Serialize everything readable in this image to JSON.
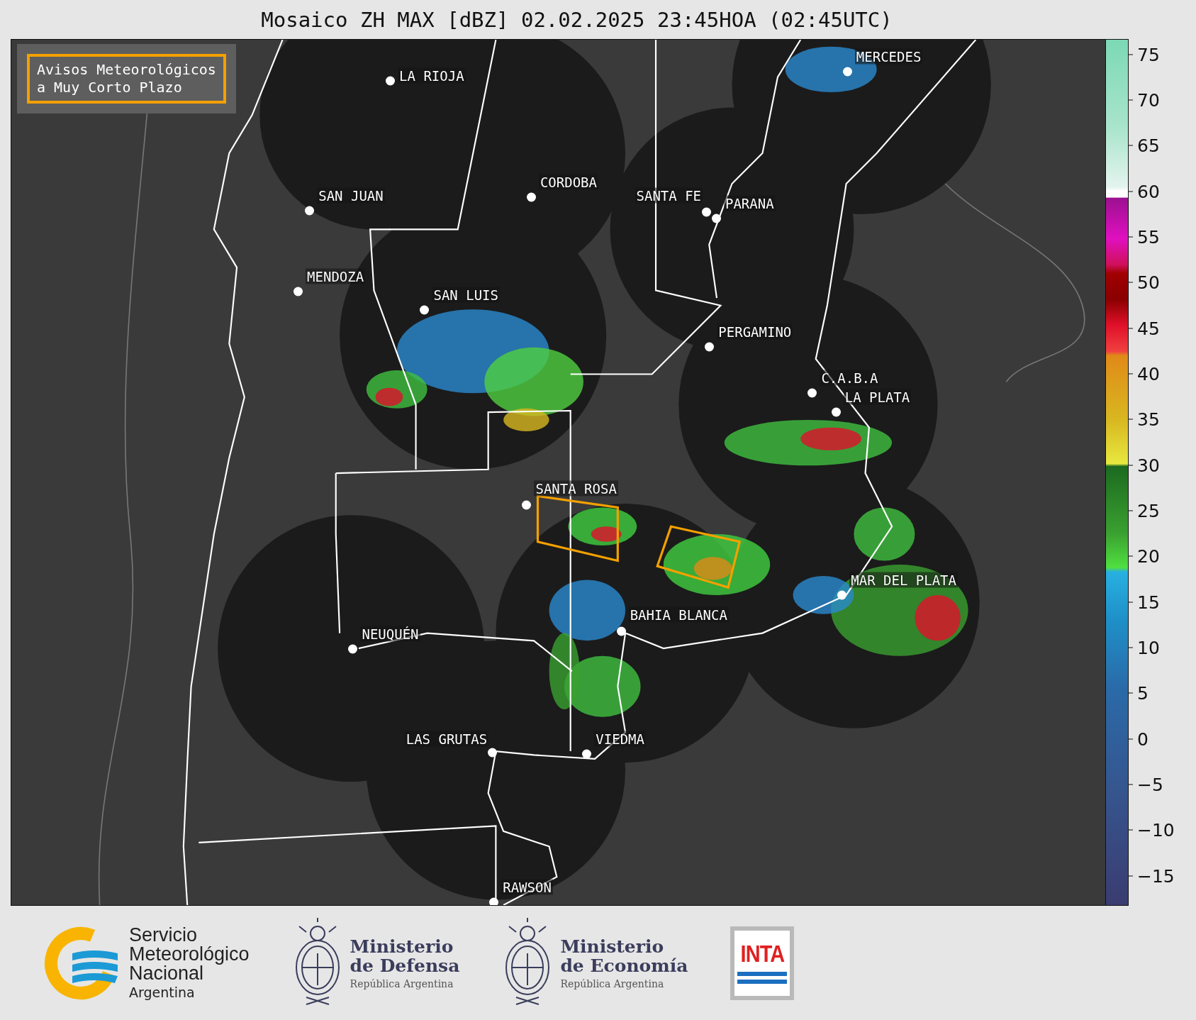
{
  "title": "Mosaico ZH MAX [dBZ] 02.02.2025 23:45HOA (02:45UTC)",
  "legend": {
    "text": "Avisos Meteorológicos a Muy Corto Plazo"
  },
  "cities": [
    {
      "name": "LA RIOJA"
    },
    {
      "name": "MERCEDES"
    },
    {
      "name": "SAN JUAN"
    },
    {
      "name": "CORDOBA"
    },
    {
      "name": "SANTA FE"
    },
    {
      "name": "PARANA"
    },
    {
      "name": "MENDOZA"
    },
    {
      "name": "SAN LUIS"
    },
    {
      "name": "PERGAMINO"
    },
    {
      "name": "C.A.B.A"
    },
    {
      "name": "LA PLATA"
    },
    {
      "name": "SANTA ROSA"
    },
    {
      "name": "MAR DEL PLATA"
    },
    {
      "name": "BAHIA BLANCA"
    },
    {
      "name": "NEUQUÉN"
    },
    {
      "name": "LAS GRUTAS"
    },
    {
      "name": "VIEDMA"
    },
    {
      "name": "RAWSON"
    }
  ],
  "colorbar": {
    "ticks": [
      "75",
      "70",
      "65",
      "60",
      "55",
      "50",
      "45",
      "40",
      "35",
      "30",
      "25",
      "20",
      "15",
      "10",
      "5",
      "0",
      "−5",
      "−10",
      "−15"
    ]
  },
  "logos": [
    {
      "kind": "smn",
      "lines": [
        "Servicio",
        "Meteorológico",
        "Nacional"
      ],
      "country": "Argentina"
    },
    {
      "kind": "ministry",
      "name": "Ministerio",
      "dept": "de Defensa",
      "country": "República Argentina"
    },
    {
      "kind": "ministry",
      "name": "Ministerio",
      "dept": "de Economía",
      "country": "República Argentina"
    },
    {
      "kind": "inta",
      "text": "INTA"
    }
  ]
}
